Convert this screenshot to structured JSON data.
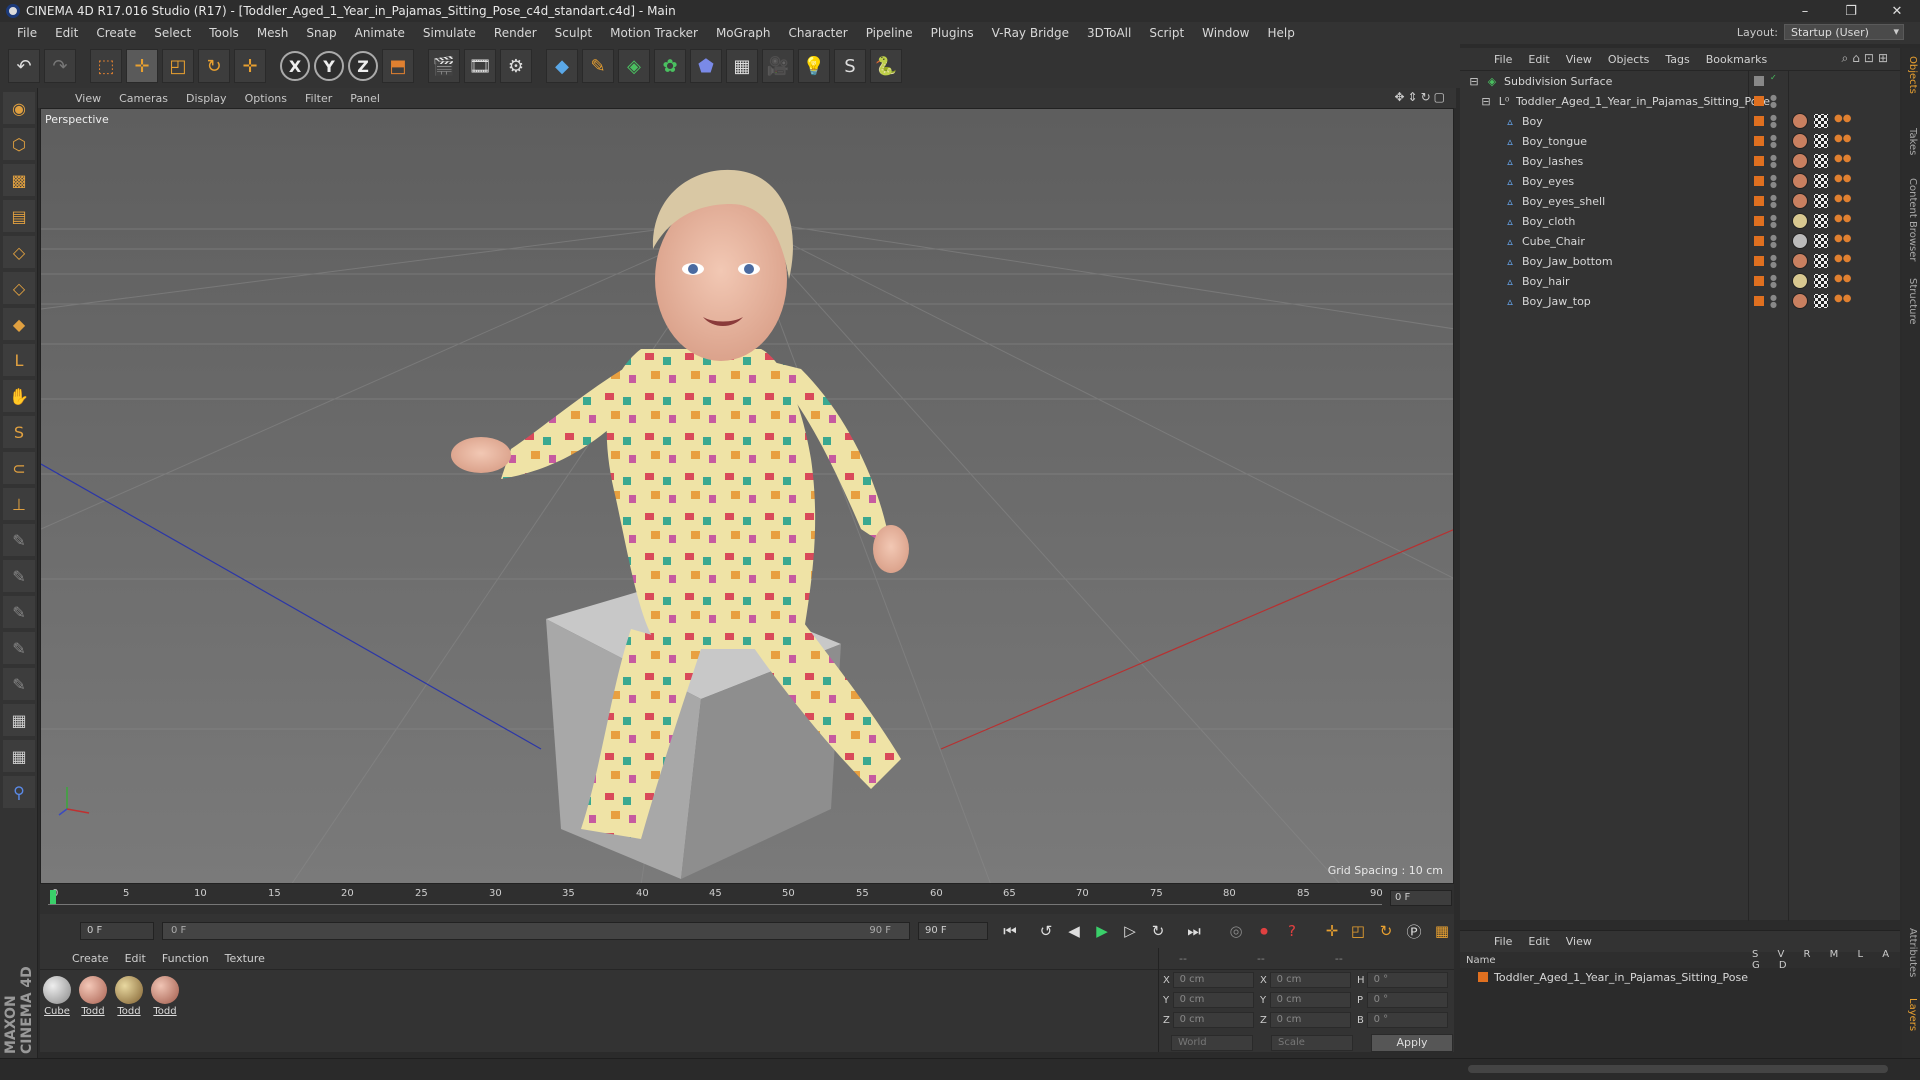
{
  "window": {
    "title": "CINEMA 4D R17.016 Studio (R17) - [Toddler_Aged_1_Year_in_Pajamas_Sitting_Pose_c4d_standart.c4d] - Main",
    "controls": [
      "–",
      "❐",
      "✕"
    ]
  },
  "menubar": {
    "items": [
      "File",
      "Edit",
      "Create",
      "Select",
      "Tools",
      "Mesh",
      "Snap",
      "Animate",
      "Simulate",
      "Render",
      "Sculpt",
      "Motion Tracker",
      "MoGraph",
      "Character",
      "Pipeline",
      "Plugins",
      "V-Ray Bridge",
      "3DToAll",
      "Script",
      "Window",
      "Help"
    ],
    "layout_label": "Layout:",
    "layout_value": "Startup (User)"
  },
  "toolbar": {
    "axis_x": "X",
    "axis_y": "Y",
    "axis_z": "Z"
  },
  "viewport": {
    "menu": [
      "View",
      "Cameras",
      "Display",
      "Options",
      "Filter",
      "Panel"
    ],
    "label": "Perspective",
    "grid_spacing": "Grid Spacing : 10 cm"
  },
  "timeline": {
    "ticks": [
      "0",
      "5",
      "10",
      "15",
      "20",
      "25",
      "30",
      "35",
      "40",
      "45",
      "50",
      "55",
      "60",
      "65",
      "70",
      "75",
      "80",
      "85",
      "90"
    ],
    "current_frame": "0 F",
    "start_field": "0 F",
    "slider_start": "0 F",
    "slider_end": "90 F",
    "end_field": "90 F"
  },
  "materials": {
    "menu": [
      "Create",
      "Edit",
      "Function",
      "Texture"
    ],
    "items": [
      {
        "label": "Cube",
        "color": "#bdbdbd"
      },
      {
        "label": "Todd",
        "color": "#d9a090"
      },
      {
        "label": "Todd",
        "color": "#c9b060"
      },
      {
        "label": "Todd",
        "color": "#d49c8c"
      }
    ]
  },
  "coordinates": {
    "head": [
      "--",
      "--",
      "--"
    ],
    "rows": [
      {
        "a1": "X",
        "v1": "0 cm",
        "a2": "X",
        "v2": "0 cm",
        "a3": "H",
        "v3": "0 °"
      },
      {
        "a1": "Y",
        "v1": "0 cm",
        "a2": "Y",
        "v2": "0 cm",
        "a3": "P",
        "v3": "0 °"
      },
      {
        "a1": "Z",
        "v1": "0 cm",
        "a2": "Z",
        "v2": "0 cm",
        "a3": "B",
        "v3": "0 °"
      }
    ],
    "world": "World",
    "scale": "Scale",
    "apply": "Apply"
  },
  "object_manager": {
    "menu": [
      "File",
      "Edit",
      "View",
      "Objects",
      "Tags",
      "Bookmarks"
    ],
    "objects": [
      {
        "name": "Subdivision Surface",
        "indent": 0
      },
      {
        "name": "Toddler_Aged_1_Year_in_Pajamas_Sitting_Pose",
        "indent": 1
      },
      {
        "name": "Boy",
        "indent": 2
      },
      {
        "name": "Boy_tongue",
        "indent": 2
      },
      {
        "name": "Boy_lashes",
        "indent": 2
      },
      {
        "name": "Boy_eyes",
        "indent": 2
      },
      {
        "name": "Boy_eyes_shell",
        "indent": 2
      },
      {
        "name": "Boy_cloth",
        "indent": 2
      },
      {
        "name": "Cube_Chair",
        "indent": 2
      },
      {
        "name": "Boy_Jaw_bottom",
        "indent": 2
      },
      {
        "name": "Boy_hair",
        "indent": 2
      },
      {
        "name": "Boy_Jaw_top",
        "indent": 2
      }
    ]
  },
  "layers": {
    "menu": [
      "File",
      "Edit",
      "View"
    ],
    "header_name": "Name",
    "header_cols": "S V R M L A G D",
    "row": "Toddler_Aged_1_Year_in_Pajamas_Sitting_Pose"
  },
  "side_tabs": [
    "Objects",
    "Takes",
    "Content Browser",
    "Structure",
    "Attributes",
    "Layers"
  ],
  "branding": "MAXON CINEMA 4D",
  "colors": {
    "accent_orange": "#e07020",
    "axis_x": "#c03030",
    "axis_z": "#3040b0",
    "axis_y": "#30a030"
  }
}
